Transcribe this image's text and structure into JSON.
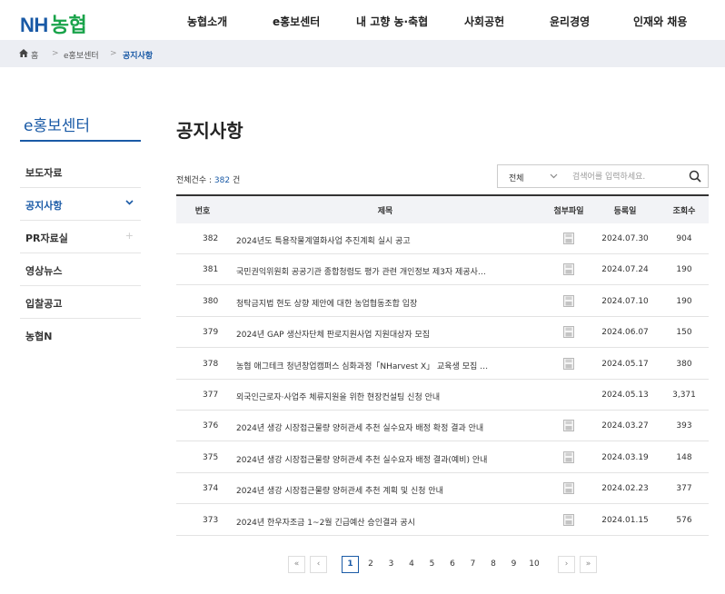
{
  "header": {
    "logo_nh": "NH",
    "logo_hangul": "농협",
    "nav": [
      "농협소개",
      "e홍보센터",
      "내 고향 농·축협",
      "사회공헌",
      "윤리경영",
      "인재와 채용"
    ]
  },
  "breadcrumb": {
    "home": "홈",
    "sep": ">",
    "level1": "e홍보센터",
    "current": "공지사항"
  },
  "sidebar": {
    "title": "e홍보센터",
    "items": [
      {
        "label": "보도자료",
        "mark": ""
      },
      {
        "label": "공지사항",
        "mark": "⌄"
      },
      {
        "label": "PR자료실",
        "mark": "+"
      },
      {
        "label": "영상뉴스",
        "mark": ""
      },
      {
        "label": "입찰공고",
        "mark": ""
      },
      {
        "label": "농협N",
        "mark": ""
      }
    ]
  },
  "main": {
    "title": "공지사항",
    "total_label": "전체건수 :",
    "total_count": "382",
    "total_unit": "건",
    "search": {
      "select_value": "전체",
      "placeholder": "검색어를 입력하세요."
    }
  },
  "table": {
    "headers": [
      "번호",
      "제목",
      "첨부파일",
      "등록일",
      "조회수"
    ],
    "rows": [
      {
        "no": "382",
        "title": "2024년도 특용작물계열화사업 추진계획 실시 공고",
        "file": true,
        "date": "2024.07.30",
        "views": "904"
      },
      {
        "no": "381",
        "title": "국민권익위원회 공공기관 종합청렴도 평가 관련 개인정보 제3자 제공사…",
        "file": true,
        "date": "2024.07.24",
        "views": "190"
      },
      {
        "no": "380",
        "title": "청탁금지법 현도 상향 제안에 대한 농업협동조합 입장",
        "file": true,
        "date": "2024.07.10",
        "views": "190"
      },
      {
        "no": "379",
        "title": "2024년 GAP 생산자단체 판로지원사업 지원대상자 모집",
        "file": true,
        "date": "2024.06.07",
        "views": "150"
      },
      {
        "no": "378",
        "title": "농협 애그테크 청년창업캠퍼스 심화과정「NHarvest X」 교육생 모집 …",
        "file": true,
        "date": "2024.05.17",
        "views": "380"
      },
      {
        "no": "377",
        "title": "외국인근로자·사업주 체류지원을 위한 현장컨설팅 신청 안내",
        "file": false,
        "date": "2024.05.13",
        "views": "3,371"
      },
      {
        "no": "376",
        "title": "2024년 생강 시장접근물량 양허관세 추천 실수요자 배정 확정 결과 안내",
        "file": true,
        "date": "2024.03.27",
        "views": "393"
      },
      {
        "no": "375",
        "title": "2024년 생강 시장접근물량 양허관세 추천 실수요자 배정 결과(예비) 안내",
        "file": true,
        "date": "2024.03.19",
        "views": "148"
      },
      {
        "no": "374",
        "title": "2024년 생강 시장접근물량 양허관세 추천 계획 및 신청 안내",
        "file": true,
        "date": "2024.02.23",
        "views": "377"
      },
      {
        "no": "373",
        "title": "2024년 한우자조금 1~2월 긴급예산 승인결과 공시",
        "file": true,
        "date": "2024.01.15",
        "views": "576"
      }
    ]
  },
  "pagination": {
    "first": "«",
    "prev": "‹",
    "pages": [
      "1",
      "2",
      "3",
      "4",
      "5",
      "6",
      "7",
      "8",
      "9",
      "10"
    ],
    "current": "1",
    "next": "›",
    "last": "»"
  },
  "colors": {
    "brand_blue": "#1a5aa6",
    "brand_green": "#19a34a",
    "breadcrumb_bg": "#eceef3"
  }
}
